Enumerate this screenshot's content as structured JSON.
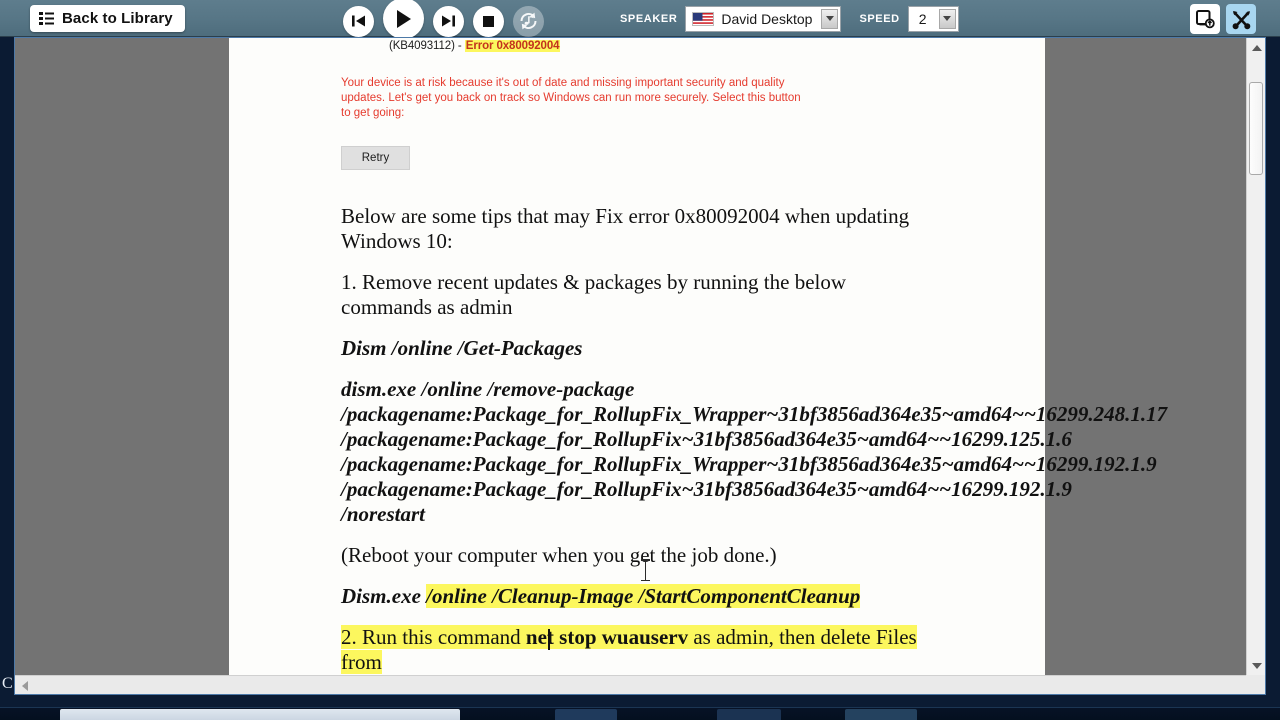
{
  "toolbar": {
    "back_label": "Back to Library",
    "back_icon": "list-icon",
    "transport": [
      {
        "name": "previous-button",
        "icon": "skip-previous-icon"
      },
      {
        "name": "play-button",
        "icon": "play-icon"
      },
      {
        "name": "next-button",
        "icon": "skip-next-icon"
      },
      {
        "name": "stop-button",
        "icon": "stop-icon"
      },
      {
        "name": "loop-audio-button",
        "icon": "repeat-music-icon"
      }
    ],
    "speaker_caption": "SPEAKER",
    "speaker_value": "David Desktop",
    "speaker_flag": "us-flag-icon",
    "speed_caption": "SPEED",
    "speed_value": "2",
    "save_audio_icon": "save-to-device-icon",
    "tools_icon": "tools-icon",
    "accent_color": "#a8d6f0",
    "bar_color": "#577686"
  },
  "document": {
    "screenshot": {
      "kb_prefix": "(KB4093112) - ",
      "kb_error": "Error 0x80092004",
      "warning": "Your device is at risk because it's out of date and missing important security and quality updates. Let's get you back on track so Windows can run more securely. Select this button to get going:",
      "retry_label": "Retry"
    },
    "paragraphs": {
      "intro": "Below are some tips that may Fix error 0x80092004 when updating Windows 10:",
      "step1": "1. Remove recent updates & packages by running the below commands as admin",
      "cmd_get_packages": "Dism /online /Get-Packages",
      "cmd_remove_line1": "dism.exe /online /remove-package",
      "cmd_remove_line2": "/packagename:Package_for_RollupFix_Wrapper~31bf3856ad364e35~amd64~~16299.248.1.17",
      "cmd_remove_line3": "/packagename:Package_for_RollupFix~31bf3856ad364e35~amd64~~16299.125.1.6",
      "cmd_remove_line4": "/packagename:Package_for_RollupFix_Wrapper~31bf3856ad364e35~amd64~~16299.192.1.9",
      "cmd_remove_line5": "/packagename:Package_for_RollupFix~31bf3856ad364e35~amd64~~16299.192.1.9 /norestart",
      "reboot_note": "(Reboot your computer when you get the job done.)",
      "cleanup_prefix": "Dism.exe ",
      "cleanup_highlight": "/online /Cleanup-Image /StartComponentCleanup",
      "step2_a": "2. Run this command ",
      "step2_b": "net stop wuauserv",
      "step2_c": " as admin, then delete Files from",
      "highlight_color": "#fcf75e"
    }
  },
  "scrollbars": {
    "vertical_up": "scroll-up-arrow",
    "vertical_down": "scroll-down-arrow",
    "horizontal_left": "scroll-left-arrow"
  },
  "edge": {
    "clipped_glyph": "C"
  }
}
